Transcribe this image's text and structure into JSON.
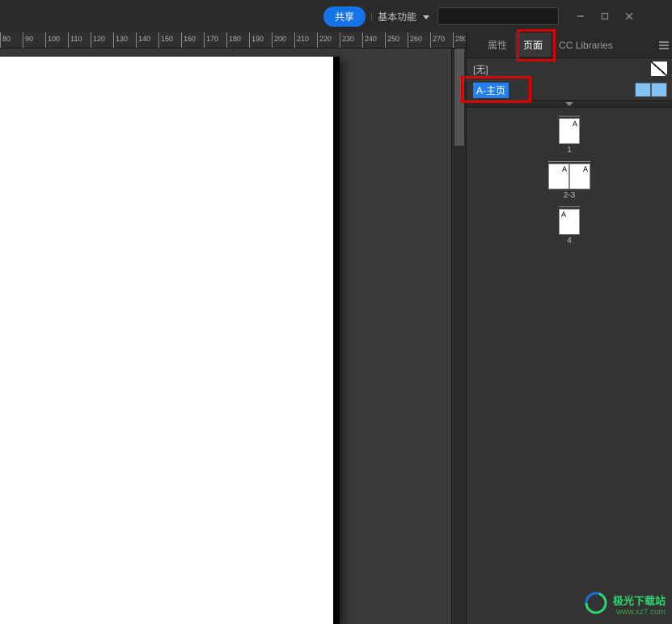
{
  "topbar": {
    "share_label": "共享",
    "mode_label": "基本功能"
  },
  "ruler": {
    "start": 80,
    "end": 460,
    "step": 10
  },
  "tabs": {
    "properties": "属性",
    "pages": "页面",
    "cc_libraries": "CC Libraries"
  },
  "masters": {
    "none_label": "[无]",
    "a_master_label": "A-主页"
  },
  "pages": {
    "items": [
      {
        "label": "1",
        "spread": [
          {
            "marker": "A",
            "side": "right"
          }
        ]
      },
      {
        "label": "2-3",
        "spread": [
          {
            "marker": "A",
            "side": "right"
          },
          {
            "marker": "A",
            "side": "right"
          }
        ]
      },
      {
        "label": "4",
        "spread": [
          {
            "marker": "A",
            "side": "left"
          }
        ]
      }
    ]
  },
  "watermark": {
    "title": "极光下载站",
    "url": "www.xz7.com"
  }
}
